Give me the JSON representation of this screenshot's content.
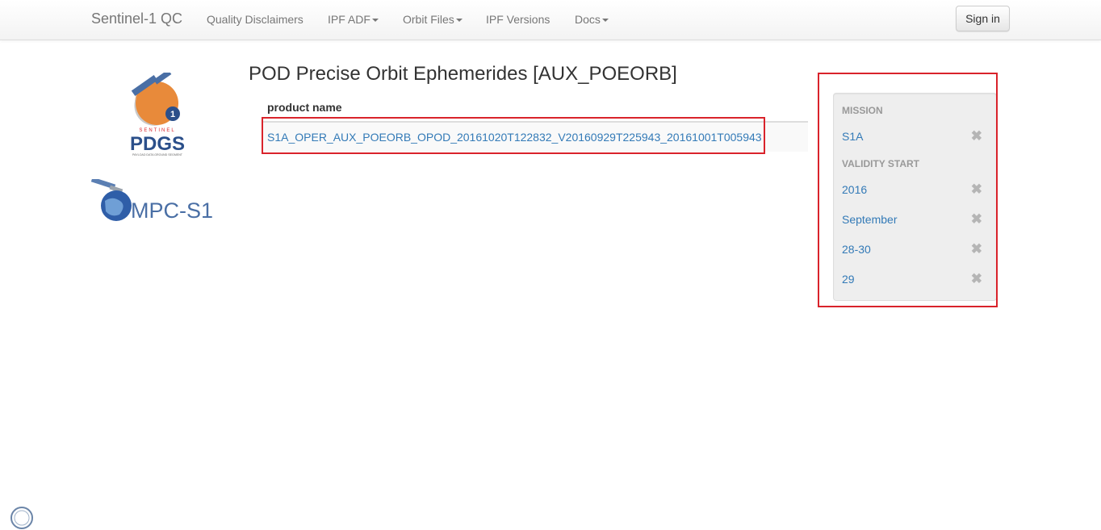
{
  "navbar": {
    "brand": "Sentinel-1 QC",
    "items": [
      {
        "label": "Quality Disclaimers",
        "dropdown": false
      },
      {
        "label": "IPF ADF",
        "dropdown": true
      },
      {
        "label": "Orbit Files",
        "dropdown": true
      },
      {
        "label": "IPF Versions",
        "dropdown": false
      },
      {
        "label": "Docs",
        "dropdown": true
      }
    ],
    "sign_in": "Sign in"
  },
  "logos": {
    "pdgs_top": "SENTINEL",
    "pdgs_main": "PDGS",
    "pdgs_bottom": "PAYLOAD DATA GROUND SEGMENT",
    "pdgs_badge": "1",
    "mpc_text": "MPC-S1"
  },
  "main": {
    "title": "POD Precise Orbit Ephemerides [AUX_POEORB]",
    "table": {
      "header": "product name",
      "rows": [
        "S1A_OPER_AUX_POEORB_OPOD_20161020T122832_V20160929T225943_20161001T005943"
      ]
    }
  },
  "sidebar": {
    "mission_header": "MISSION",
    "mission": "S1A",
    "validity_header": "VALIDITY START",
    "year": "2016",
    "month": "September",
    "day_range": "28-30",
    "day": "29",
    "remove_glyph": "✖"
  },
  "colors": {
    "link": "#337ab7",
    "highlight": "#d9232b",
    "nav_text": "#777777"
  }
}
